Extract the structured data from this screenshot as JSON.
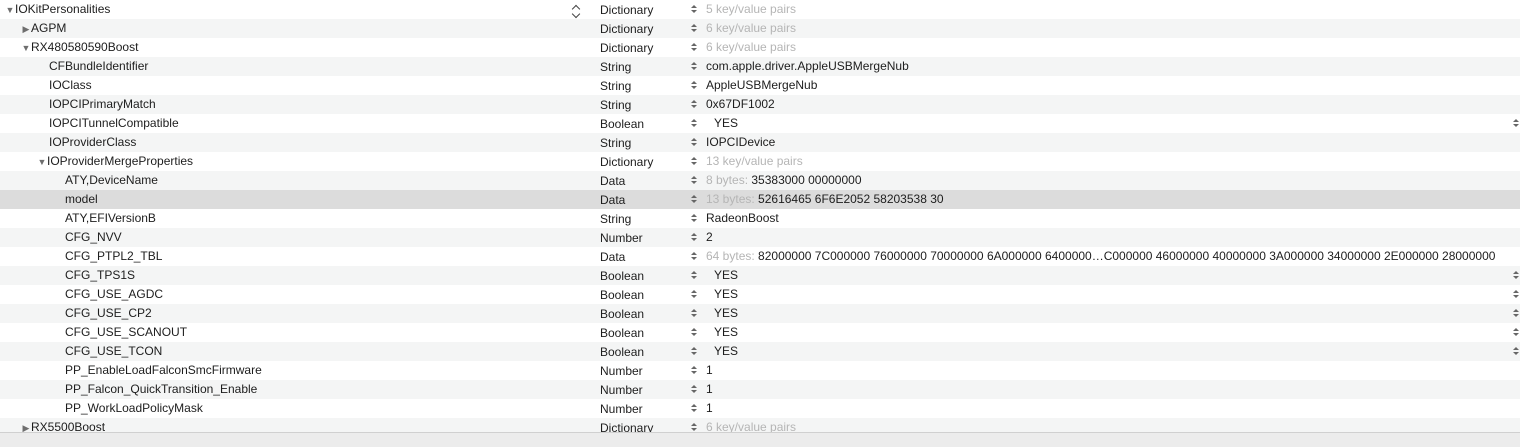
{
  "root": {
    "key": "IOKitPersonalities",
    "type": "Dictionary",
    "value_hint": "5 key/value pairs"
  },
  "rows": [
    {
      "id": "agpm",
      "key": "AGPM",
      "type": "Dictionary",
      "value_hint": "6 key/value pairs",
      "disclosure": "collapsed"
    },
    {
      "id": "rx480",
      "key": "RX480580590Boost",
      "type": "Dictionary",
      "value_hint": "6 key/value pairs",
      "disclosure": "expanded"
    },
    {
      "id": "cfbundleidentifier",
      "key": "CFBundleIdentifier",
      "type": "String",
      "value": "com.apple.driver.AppleUSBMergeNub"
    },
    {
      "id": "ioclass",
      "key": "IOClass",
      "type": "String",
      "value": "AppleUSBMergeNub"
    },
    {
      "id": "iopciprimarymatch",
      "key": "IOPCIPrimaryMatch",
      "type": "String",
      "value": "0x67DF1002"
    },
    {
      "id": "iopcitunnelcompatible",
      "key": "IOPCITunnelCompatible",
      "type": "Boolean",
      "value": "YES"
    },
    {
      "id": "ioproviderclass",
      "key": "IOProviderClass",
      "type": "String",
      "value": "IOPCIDevice"
    },
    {
      "id": "ioprovidermergeproperties",
      "key": "IOProviderMergeProperties",
      "type": "Dictionary",
      "value_hint": "13 key/value pairs",
      "disclosure": "expanded"
    },
    {
      "id": "aty-devicename",
      "key": "ATY,DeviceName",
      "type": "Data",
      "value_hint": "8 bytes:",
      "value": "35383000 00000000"
    },
    {
      "id": "model",
      "key": "model",
      "type": "Data",
      "value_hint": "13 bytes:",
      "value": "52616465 6F6E2052 58203538 30",
      "selected": true
    },
    {
      "id": "aty-efiversionb",
      "key": "ATY,EFIVersionB",
      "type": "String",
      "value": "RadeonBoost"
    },
    {
      "id": "cfg-nvv",
      "key": "CFG_NVV",
      "type": "Number",
      "value": "2"
    },
    {
      "id": "cfg-ptpl2-tbl",
      "key": "CFG_PTPL2_TBL",
      "type": "Data",
      "value_hint": "64 bytes:",
      "value": "82000000 7C000000 76000000 70000000 6A000000 6400000…C000000 46000000 40000000 3A000000 34000000 2E000000 28000000"
    },
    {
      "id": "cfg-tps1s",
      "key": "CFG_TPS1S",
      "type": "Boolean",
      "value": "YES"
    },
    {
      "id": "cfg-use-agdc",
      "key": "CFG_USE_AGDC",
      "type": "Boolean",
      "value": "YES"
    },
    {
      "id": "cfg-use-cp2",
      "key": "CFG_USE_CP2",
      "type": "Boolean",
      "value": "YES"
    },
    {
      "id": "cfg-use-scanout",
      "key": "CFG_USE_SCANOUT",
      "type": "Boolean",
      "value": "YES"
    },
    {
      "id": "cfg-use-tcon",
      "key": "CFG_USE_TCON",
      "type": "Boolean",
      "value": "YES"
    },
    {
      "id": "pp-enableloadfalconsmcfirmware",
      "key": "PP_EnableLoadFalconSmcFirmware",
      "type": "Number",
      "value": "1"
    },
    {
      "id": "pp-falcon-quicktransition-enable",
      "key": "PP_Falcon_QuickTransition_Enable",
      "type": "Number",
      "value": "1"
    },
    {
      "id": "pp-workloadpolicymask",
      "key": "PP_WorkLoadPolicyMask",
      "type": "Number",
      "value": "1"
    },
    {
      "id": "rx5500",
      "key": "RX5500Boost",
      "type": "Dictionary",
      "value_hint": "6 key/value pairs",
      "disclosure": "collapsed"
    }
  ],
  "icons": {
    "expanded": "disclosure-triangle-down",
    "collapsed": "disclosure-triangle-right",
    "stepper": "up-down-chevron",
    "popup": "popup-chevron"
  },
  "colors": {
    "alt_row": "#f4f5f5",
    "selected_row": "#dcdcdc",
    "hint_text": "#b5b5b5"
  }
}
